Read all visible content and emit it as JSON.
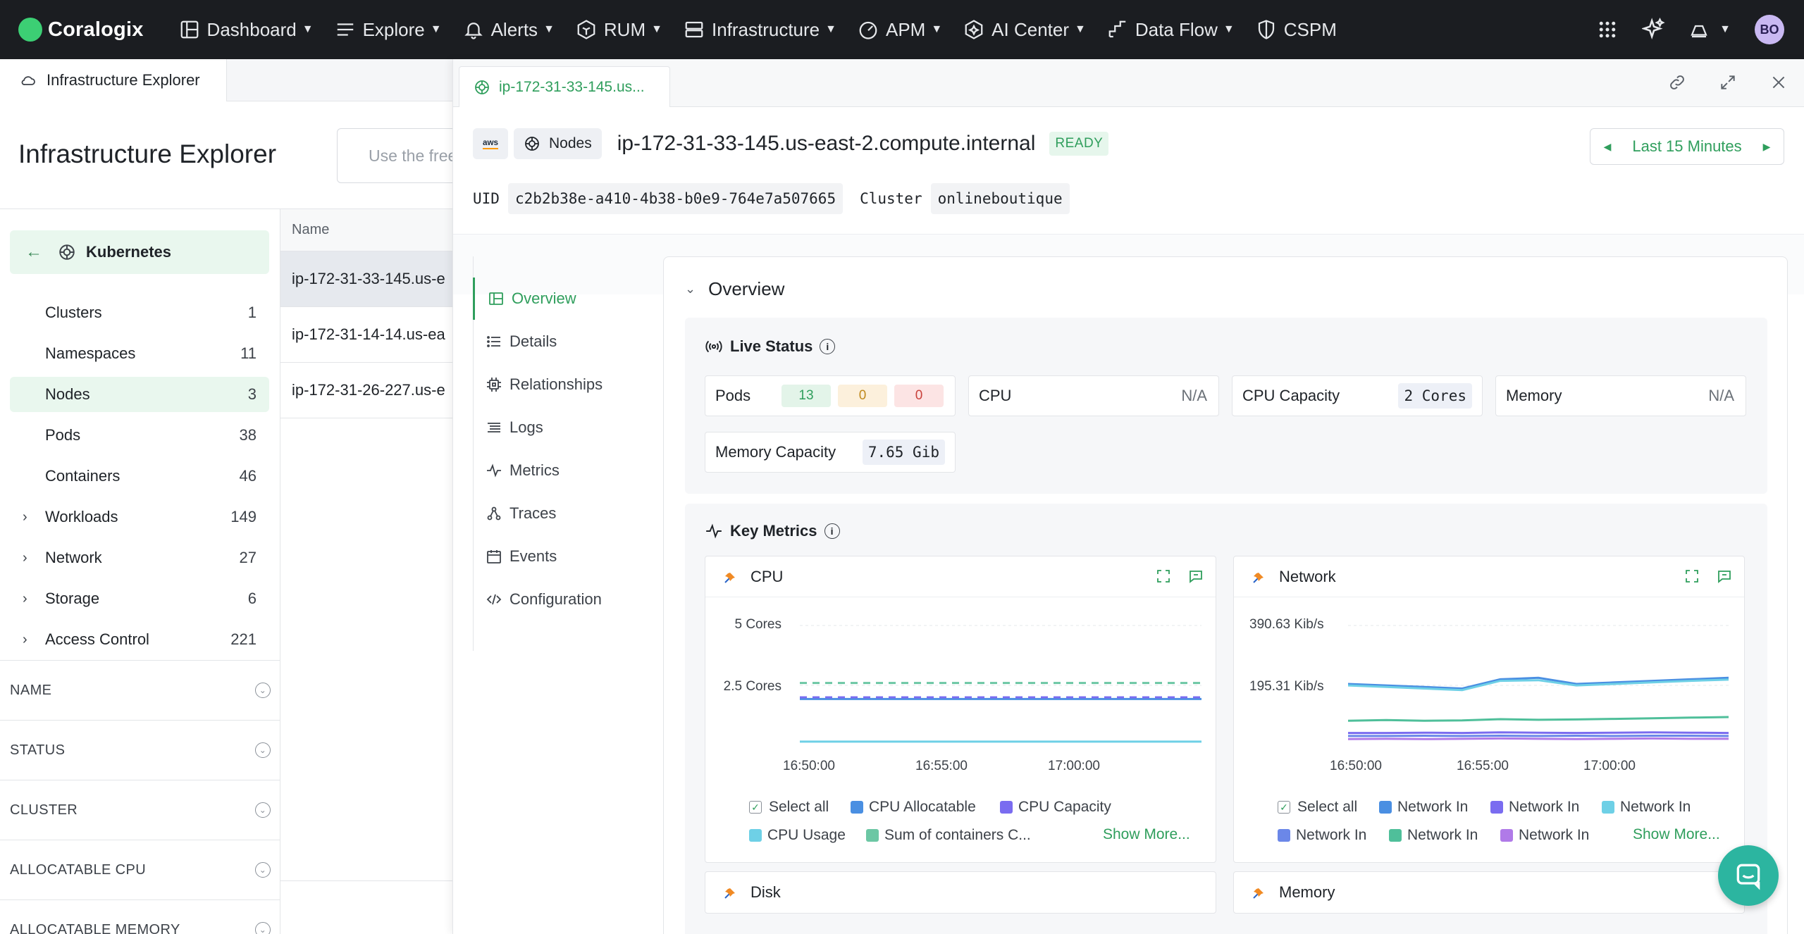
{
  "brand": {
    "name": "Coralogix"
  },
  "nav": [
    {
      "label": "Dashboard",
      "icon": "dashboard-icon",
      "caret": true
    },
    {
      "label": "Explore",
      "icon": "explore-icon",
      "caret": true
    },
    {
      "label": "Alerts",
      "icon": "bell-icon",
      "caret": true
    },
    {
      "label": "RUM",
      "icon": "rum-icon",
      "caret": true
    },
    {
      "label": "Infrastructure",
      "icon": "infrastructure-icon",
      "caret": true
    },
    {
      "label": "APM",
      "icon": "gauge-icon",
      "caret": true
    },
    {
      "label": "AI Center",
      "icon": "ai-center-icon",
      "caret": true
    },
    {
      "label": "Data Flow",
      "icon": "data-flow-icon",
      "caret": true
    },
    {
      "label": "CSPM",
      "icon": "shield-icon",
      "caret": false
    }
  ],
  "user": {
    "initials": "BO"
  },
  "left_tab": {
    "label": "Infrastructure Explorer"
  },
  "page": {
    "title": "Infrastructure Explorer",
    "search_placeholder": "Use the free"
  },
  "tree": {
    "root": "Kubernetes",
    "items": [
      {
        "label": "Clusters",
        "count": "1"
      },
      {
        "label": "Namespaces",
        "count": "11"
      },
      {
        "label": "Nodes",
        "count": "3"
      },
      {
        "label": "Pods",
        "count": "38"
      },
      {
        "label": "Containers",
        "count": "46"
      },
      {
        "label": "Workloads",
        "count": "149"
      },
      {
        "label": "Network",
        "count": "27"
      },
      {
        "label": "Storage",
        "count": "6"
      },
      {
        "label": "Access Control",
        "count": "221"
      }
    ]
  },
  "filters": [
    "NAME",
    "STATUS",
    "CLUSTER",
    "ALLOCATABLE CPU",
    "ALLOCATABLE MEMORY"
  ],
  "list": {
    "header": "Name",
    "rows": [
      "ip-172-31-33-145.us-e",
      "ip-172-31-14-14.us-ea",
      "ip-172-31-26-227.us-e"
    ]
  },
  "drawer": {
    "tab_label": "ip-172-31-33-145.us...",
    "provider": "aws",
    "kind": "Nodes",
    "title": "ip-172-31-33-145.us-east-2.compute.internal",
    "status": "READY",
    "time_range": "Last 15 Minutes",
    "uid_key": "UID",
    "uid": "c2b2b38e-a410-4b38-b0e9-764e7a507665",
    "cluster_key": "Cluster",
    "cluster": "onlineboutique"
  },
  "subnav": [
    "Overview",
    "Details",
    "Relationships",
    "Logs",
    "Metrics",
    "Traces",
    "Events",
    "Configuration"
  ],
  "overview": {
    "title": "Overview",
    "live_status": "Live Status",
    "pods_label": "Pods",
    "pods_values": [
      "13",
      "0",
      "0"
    ],
    "cpu_label": "CPU",
    "cpu_value": "N/A",
    "cpu_cap_label": "CPU Capacity",
    "cpu_cap_value": "2 Cores",
    "memory_label": "Memory",
    "memory_value": "N/A",
    "mem_cap_label": "Memory Capacity",
    "mem_cap_value": "7.65 Gib",
    "key_metrics": "Key Metrics"
  },
  "chart_data": [
    {
      "type": "line",
      "title": "CPU",
      "y_ticks": [
        "5 Cores",
        "2.5 Cores"
      ],
      "ylim": [
        0,
        5
      ],
      "x_ticks": [
        "16:50:00",
        "16:55:00",
        "17:00:00"
      ],
      "series": [
        {
          "name": "CPU Allocatable",
          "color": "#4a8fe2",
          "values": [
            1.93,
            1.93,
            1.93,
            1.93,
            1.93
          ]
        },
        {
          "name": "CPU Capacity",
          "color": "#7a6cf0",
          "values": [
            2.0,
            2.0,
            2.0,
            2.0,
            2.0
          ]
        },
        {
          "name": "CPU Usage",
          "color": "#6ed0e6",
          "values": [
            0.15,
            0.15,
            0.15,
            0.15,
            0.15
          ]
        },
        {
          "name": "Sum of containers C...",
          "color": "#6cc7a4",
          "values": [
            2.6,
            2.6,
            2.6,
            2.6,
            2.6
          ]
        }
      ],
      "legend": {
        "select_all": "Select all",
        "show_more": "Show More..."
      }
    },
    {
      "type": "line",
      "title": "Network",
      "y_ticks": [
        "390.63 Kib/s",
        "195.31 Kib/s"
      ],
      "ylim": [
        0,
        390.63
      ],
      "x_ticks": [
        "16:50:00",
        "16:55:00",
        "17:00:00"
      ],
      "series": [
        {
          "name": "Network In",
          "color": "#4a8fe2",
          "values": [
            200,
            195,
            190,
            185,
            215,
            220,
            200,
            205,
            210,
            215,
            220
          ]
        },
        {
          "name": "Network In",
          "color": "#7a6cf0",
          "values": [
            40,
            40,
            41,
            40,
            42,
            41,
            40,
            41,
            42,
            41,
            40
          ]
        },
        {
          "name": "Network In",
          "color": "#6ed0e6",
          "values": [
            195,
            190,
            185,
            180,
            210,
            212,
            195,
            200,
            205,
            210,
            214
          ]
        },
        {
          "name": "Network In",
          "color": "#6b87e8",
          "values": [
            30,
            30,
            31,
            30,
            31,
            30,
            31,
            30,
            31,
            31,
            30
          ]
        },
        {
          "name": "Network In",
          "color": "#4fbf9a",
          "values": [
            80,
            82,
            80,
            81,
            85,
            83,
            84,
            86,
            88,
            90,
            92
          ]
        },
        {
          "name": "Network In",
          "color": "#b07ae8",
          "values": [
            20,
            21,
            20,
            21,
            22,
            21,
            20,
            21,
            22,
            21,
            21
          ]
        }
      ],
      "legend": {
        "select_all": "Select all",
        "show_more": "Show More..."
      }
    }
  ],
  "bottom_cards": [
    "Disk",
    "Memory"
  ]
}
